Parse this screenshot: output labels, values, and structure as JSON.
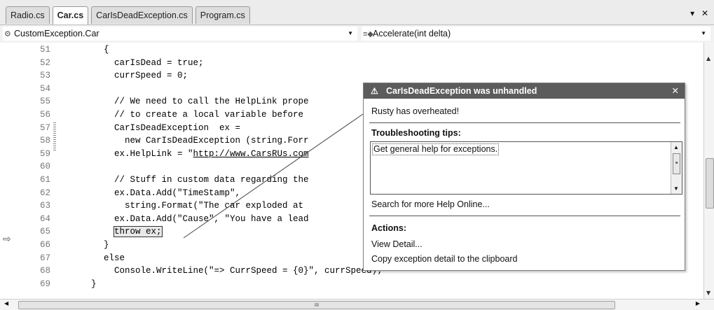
{
  "tabs": [
    {
      "label": "Radio.cs",
      "active": false
    },
    {
      "label": "Car.cs",
      "active": true
    },
    {
      "label": "CarIsDeadException.cs",
      "active": false
    },
    {
      "label": "Program.cs",
      "active": false
    }
  ],
  "tab_controls": {
    "dropdown": "▾",
    "close": "✕"
  },
  "nav": {
    "type_combo": "CustomException.Car",
    "member_combo": "Accelerate(int delta)"
  },
  "code": {
    "line_numbers": [
      "51",
      "52",
      "53",
      "54",
      "55",
      "56",
      "57",
      "58",
      "59",
      "60",
      "61",
      "62",
      "63",
      "64",
      "65",
      "66",
      "67",
      "68",
      "69"
    ],
    "lines": [
      "{",
      "  carIsDead = true;",
      "  currSpeed = 0;",
      "",
      "  // We need to call the HelpLink prope",
      "  // to create a local variable before",
      "  CarIsDeadException  ex =",
      "    new CarIsDeadException (string.Forr",
      "  ex.HelpLink = \"http://www.CarsRUs.com",
      "",
      "  // Stuff in custom data regarding the",
      "  ex.Data.Add(\"TimeStamp\",",
      "    string.Format(\"The car exploded at",
      "  ex.Data.Add(\"Cause\", \"You have a lead",
      "  throw ex;",
      "}",
      "else",
      "  Console.WriteLine(\"=> CurrSpeed = {0}\", currSpeed);",
      "}"
    ],
    "url_prefix": "  ex.HelpLink = \"",
    "url_text": "http://www.CarsRUs.com",
    "throw_prefix": "  ",
    "throw_text": "throw ex;"
  },
  "exception_popup": {
    "title": "CarIsDeadException was unhandled",
    "close": "✕",
    "message": "Rusty has overheated!",
    "troubleshooting_header": "Troubleshooting tips:",
    "tip": "Get general help for exceptions.",
    "search_link": "Search for more Help Online...",
    "actions_header": "Actions:",
    "action_view_detail": "View Detail...",
    "action_copy": "Copy exception detail to the clipboard"
  },
  "scroll_grip": "III"
}
